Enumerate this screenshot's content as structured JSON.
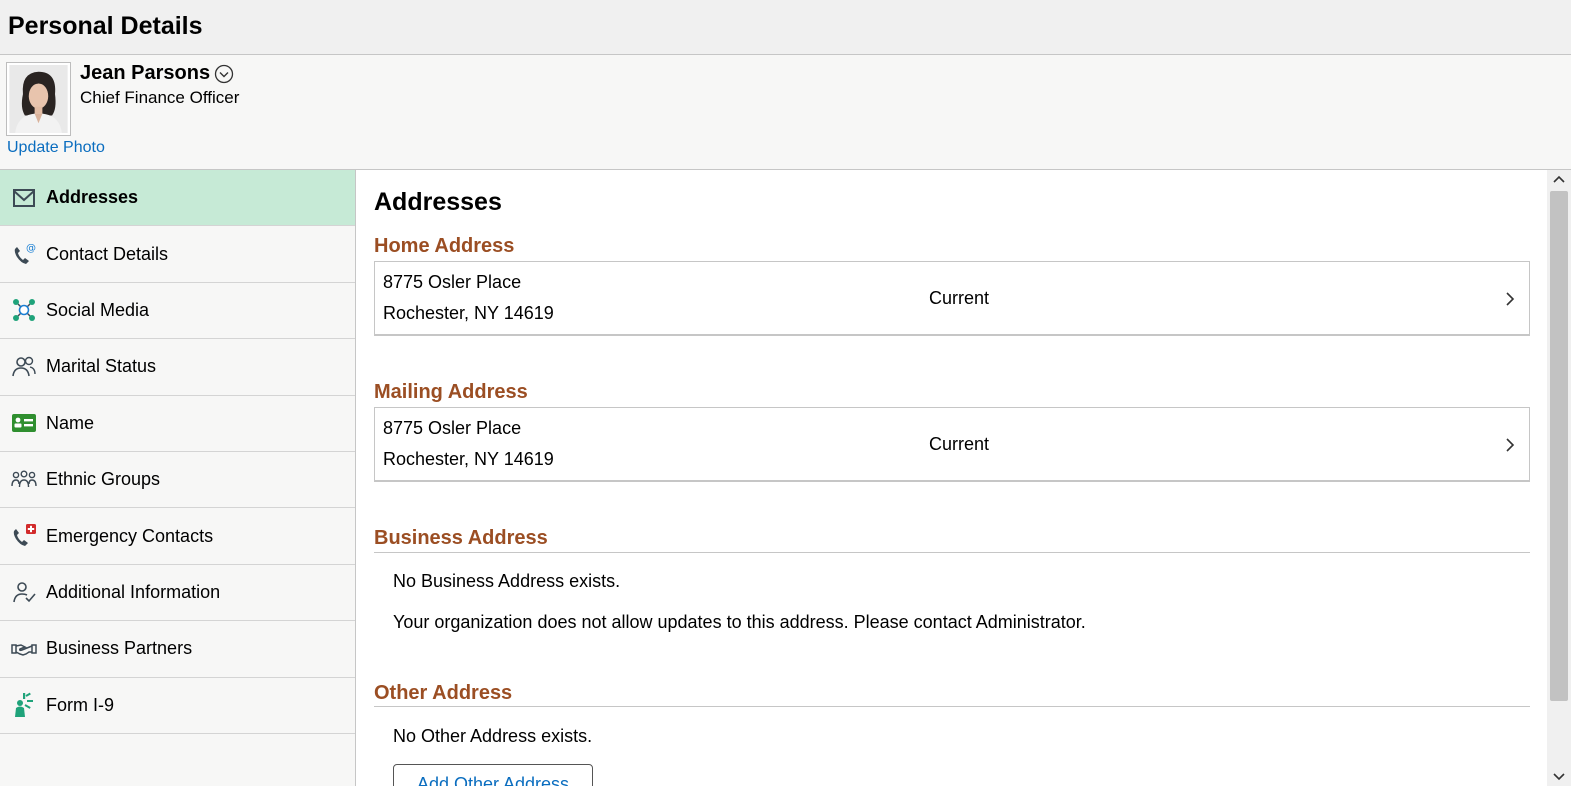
{
  "page": {
    "title": "Personal Details"
  },
  "profile": {
    "name": "Jean Parsons",
    "job_title": "Chief Finance Officer",
    "update_photo": "Update Photo"
  },
  "sidebar": {
    "items": [
      {
        "label": "Addresses",
        "icon": "envelope-icon",
        "active": true
      },
      {
        "label": "Contact Details",
        "icon": "phone-at-icon"
      },
      {
        "label": "Social Media",
        "icon": "network-icon"
      },
      {
        "label": "Marital Status",
        "icon": "people-icon"
      },
      {
        "label": "Name",
        "icon": "id-card-icon"
      },
      {
        "label": "Ethnic Groups",
        "icon": "group-icon"
      },
      {
        "label": "Emergency Contacts",
        "icon": "phone-emergency-icon"
      },
      {
        "label": "Additional Information",
        "icon": "person-check-icon"
      },
      {
        "label": "Business Partners",
        "icon": "handshake-icon"
      },
      {
        "label": "Form I-9",
        "icon": "liberty-icon"
      }
    ]
  },
  "main": {
    "heading": "Addresses",
    "home": {
      "title": "Home Address",
      "line1": "8775 Osler Place",
      "line2": "Rochester, NY 14619",
      "status": "Current"
    },
    "mailing": {
      "title": "Mailing Address",
      "line1": "8775 Osler Place",
      "line2": "Rochester, NY 14619",
      "status": "Current"
    },
    "business": {
      "title": "Business Address",
      "msg1": "No Business Address exists.",
      "msg2": "Your organization does not allow updates to this address. Please contact Administrator."
    },
    "other": {
      "title": "Other Address",
      "msg": "No Other Address exists.",
      "button": "Add Other Address"
    }
  },
  "colors": {
    "accent": "#9b4e23",
    "link": "#0a6dbf",
    "active_nav": "#c6ead6"
  }
}
